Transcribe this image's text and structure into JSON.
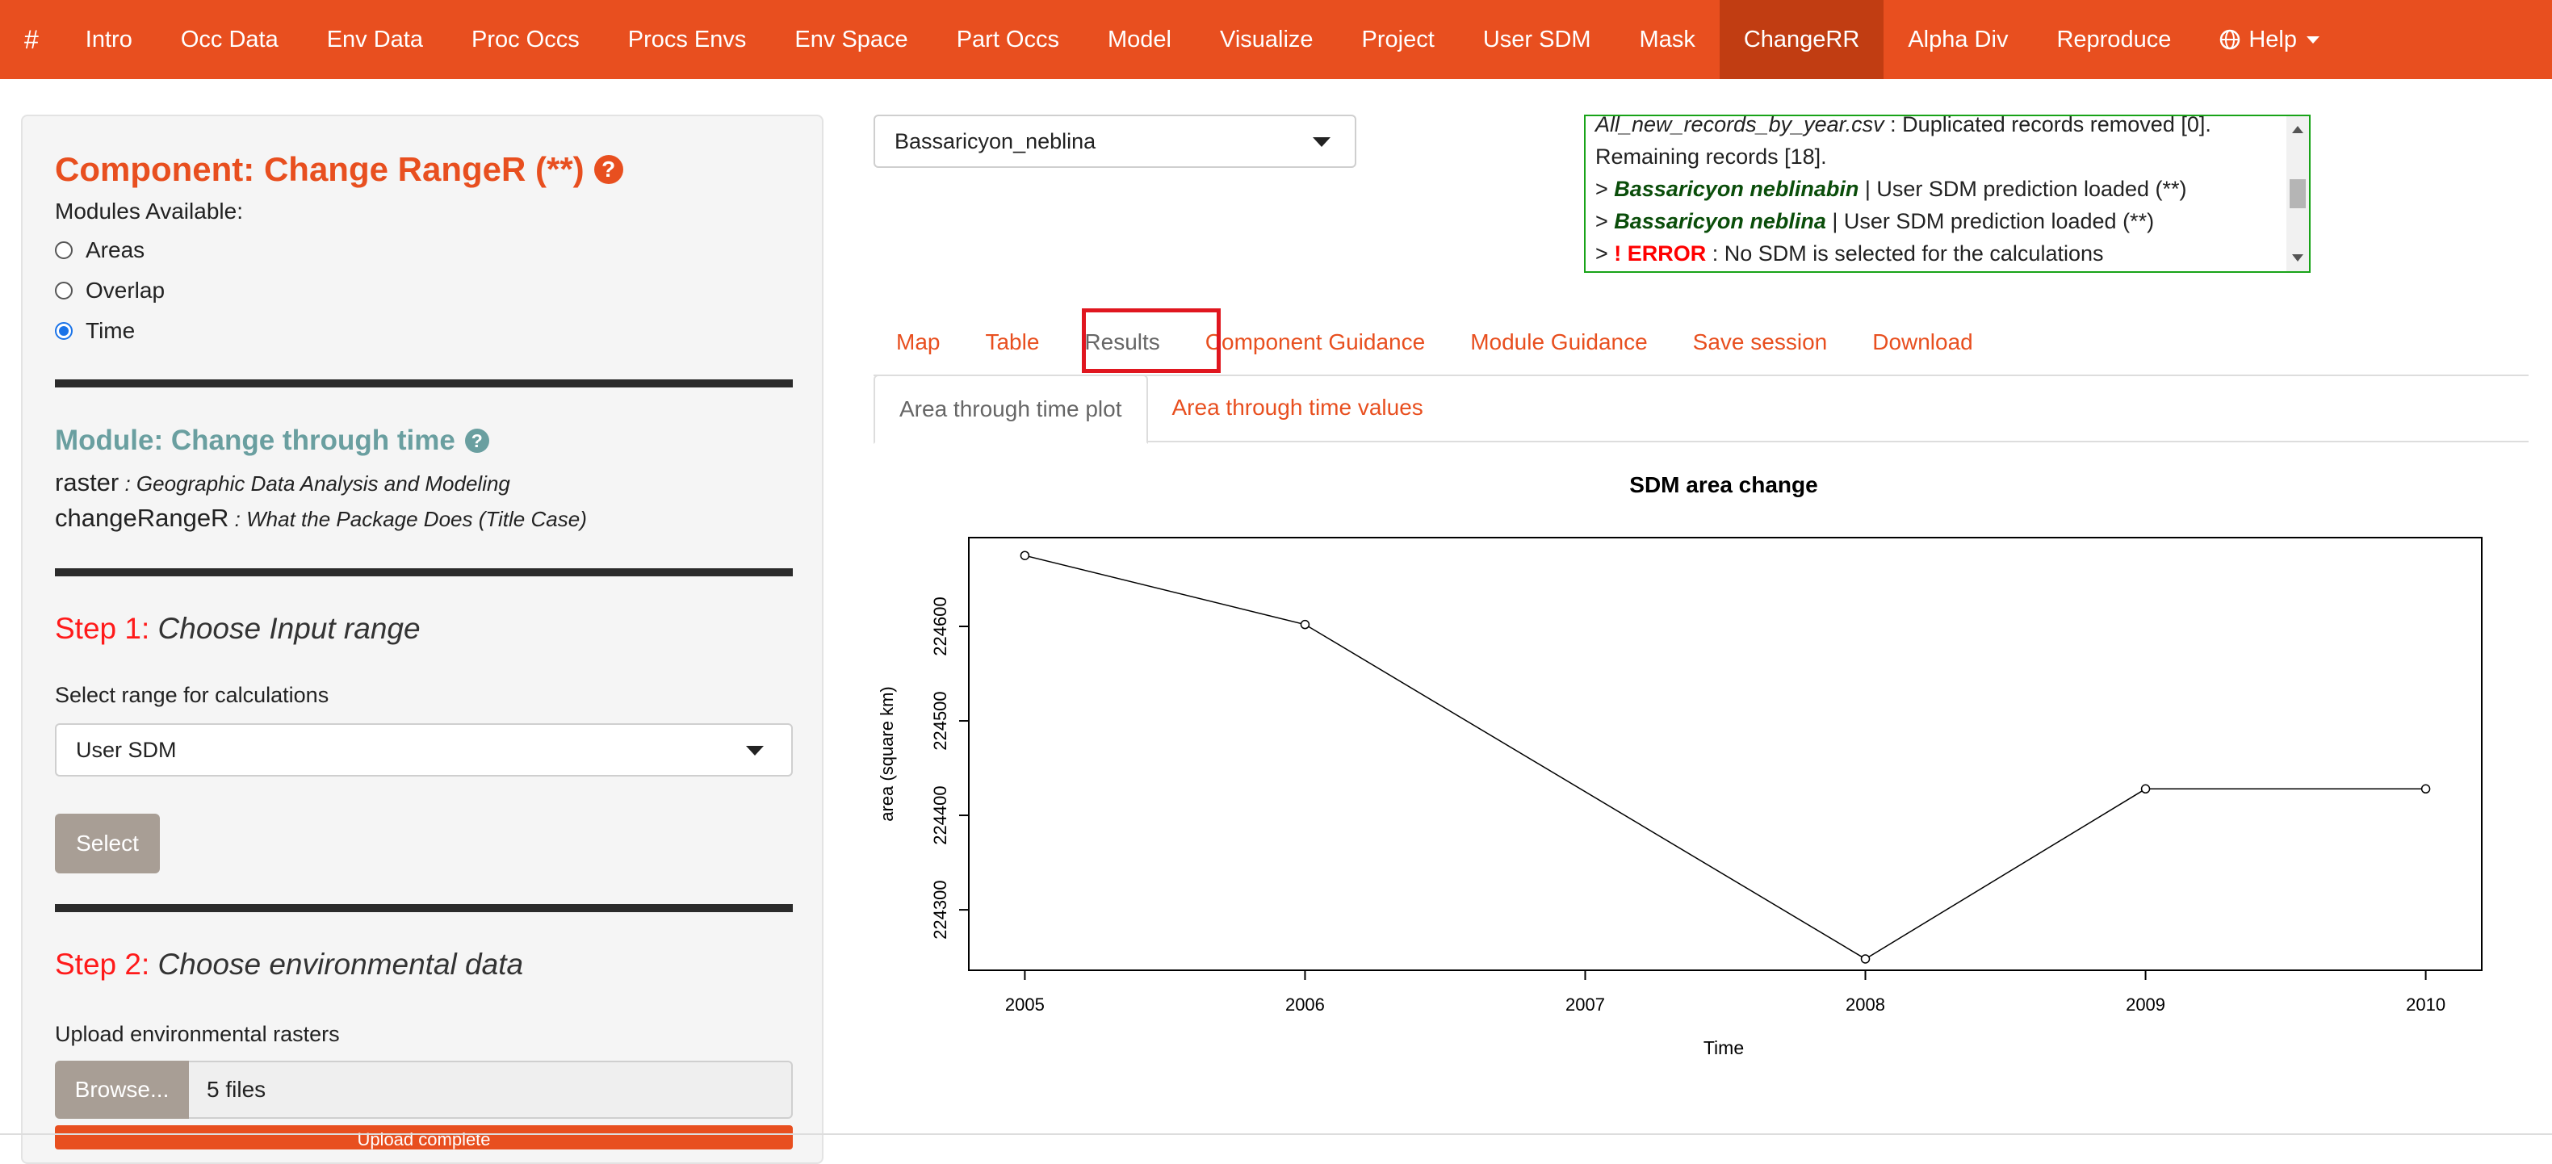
{
  "navbar": {
    "brand": "#",
    "items": [
      "Intro",
      "Occ Data",
      "Env Data",
      "Proc Occs",
      "Procs Envs",
      "Env Space",
      "Part Occs",
      "Model",
      "Visualize",
      "Project",
      "User SDM",
      "Mask",
      "ChangeRR",
      "Alpha Div",
      "Reproduce"
    ],
    "active": "ChangeRR",
    "help_label": "Help",
    "help_icon": "globe-icon"
  },
  "sidebar": {
    "component_title": "Component: Change RangeR (**)",
    "modules_label": "Modules Available:",
    "modules": [
      "Areas",
      "Overlap",
      "Time"
    ],
    "selected_module": "Time",
    "module_title": "Module: Change through time",
    "packages": [
      {
        "name": "raster",
        "desc": " : Geographic Data Analysis and Modeling"
      },
      {
        "name": "changeRangeR",
        "desc": " : What the Package Does (Title Case)"
      }
    ],
    "step1": {
      "num": "Step 1:",
      "text": " Choose Input range"
    },
    "range_label": "Select range for calculations",
    "range_value": "User SDM",
    "select_button": "Select",
    "step2": {
      "num": "Step 2:",
      "text": " Choose environmental data"
    },
    "upload_label": "Upload environmental rasters",
    "browse_button": "Browse...",
    "file_status": "5 files",
    "upload_progress": "Upload complete"
  },
  "species_select": {
    "value": "Bassaricyon_neblina"
  },
  "log": {
    "line1_file": "All_new_records_by_year.csv",
    "line1_rest": " : Duplicated records removed [0].",
    "line2": "Remaining records [18].",
    "line3_species": "Bassaricyon neblinabin",
    "line3_rest": " | User SDM prediction loaded (**)",
    "line4_species": "Bassaricyon neblina",
    "line4_rest": " | User SDM prediction loaded (**)",
    "line5_err": "! ERROR",
    "line5_rest": " : No SDM is selected for the calculations",
    "prompt": "> "
  },
  "tabs": [
    "Map",
    "Table",
    "Results",
    "Component Guidance",
    "Module Guidance",
    "Save session",
    "Download"
  ],
  "active_tab": "Results",
  "subtabs": [
    "Area through time plot",
    "Area through time values"
  ],
  "active_subtab": "Area through time plot",
  "colors": {
    "accent": "#e84f1f",
    "accent_dark": "#c13d12",
    "teal": "#6a9fa0",
    "log_border": "#18a318",
    "highlight": "#e0161f"
  },
  "chart_data": {
    "type": "line",
    "title": "SDM area change",
    "xlabel": "Time",
    "ylabel": "area (square km)",
    "x": [
      2005,
      2006,
      2007,
      2008,
      2009,
      2010
    ],
    "points": [
      {
        "x": 2005,
        "y": 224675
      },
      {
        "x": 2006,
        "y": 224602
      },
      {
        "x": 2008,
        "y": 224248
      },
      {
        "x": 2009,
        "y": 224428
      },
      {
        "x": 2010,
        "y": 224428
      }
    ],
    "xticks": [
      2005,
      2006,
      2007,
      2008,
      2009,
      2010
    ],
    "yticks": [
      224300,
      224400,
      224500,
      224600
    ],
    "xlim": [
      2004.8,
      2010.2
    ],
    "ylim": [
      224236,
      224694
    ],
    "grid": false,
    "marker": "open-circle"
  }
}
